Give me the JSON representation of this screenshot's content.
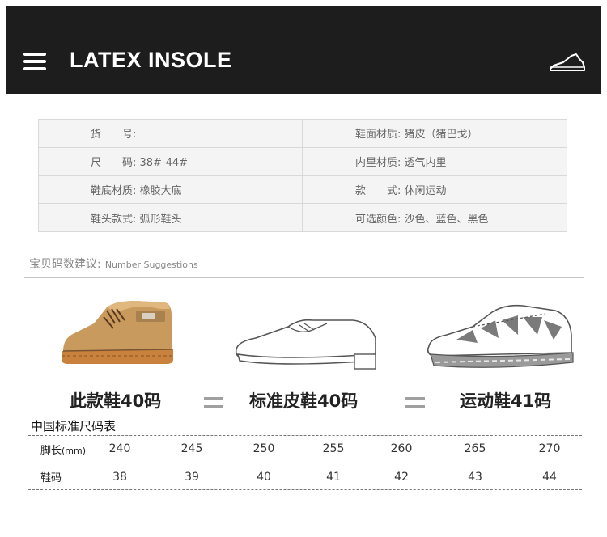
{
  "header": {
    "brand": "LATEX INSOLE",
    "menu_icon": "hamburger-menu-icon",
    "shoe_icon": "sneaker-outline-icon"
  },
  "specs": [
    {
      "left": "货　　号:",
      "right": "鞋面材质: 猪皮（猪巴戈）"
    },
    {
      "left": "尺　　码: 38#-44#",
      "right": "内里材质: 透气内里"
    },
    {
      "left": "鞋底材质: 橡胶大底",
      "right": "款　　式: 休闲运动"
    },
    {
      "left": "鞋头款式: 弧形鞋头",
      "right": "可选颜色: 沙色、蓝色、黑色"
    }
  ],
  "suggestion": {
    "label": "宝贝码数建议:",
    "label_en": "Number Suggestions"
  },
  "comparison": {
    "this_shoe": "此款鞋40码",
    "leather_shoe": "标准皮鞋40码",
    "sports_shoe": "运动鞋41码"
  },
  "size_chart": {
    "title": "中国标准尺码表",
    "foot_length_label": "脚长",
    "foot_length_unit": "(mm)",
    "foot_length": [
      "240",
      "245",
      "250",
      "255",
      "260",
      "265",
      "270"
    ],
    "shoe_size_label": "鞋码",
    "shoe_size": [
      "38",
      "39",
      "40",
      "41",
      "42",
      "43",
      "44"
    ]
  },
  "colors": {
    "header_bg": "#1d1d1d",
    "boot_tan": "#c99a5e",
    "boot_sole": "#c8823e",
    "runner_accent": "#7a7a7a"
  }
}
